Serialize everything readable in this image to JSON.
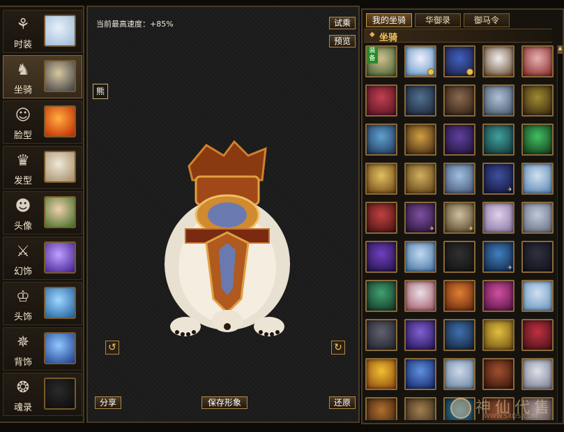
{
  "sidebar": {
    "items": [
      {
        "label": "时装",
        "icon": "fashion-robe-icon",
        "glyph": "⚘",
        "thumb": [
          "#e8f0f8",
          "#9ab8d8"
        ],
        "active": false
      },
      {
        "label": "坐骑",
        "icon": "horse-head-icon",
        "glyph": "♞",
        "thumb": [
          "#d8c8a0",
          "#3a3a40"
        ],
        "active": true
      },
      {
        "label": "脸型",
        "icon": "face-icon",
        "glyph": "☺",
        "thumb": [
          "#ffb040",
          "#c02000"
        ],
        "active": false
      },
      {
        "label": "发型",
        "icon": "hairstyle-icon",
        "glyph": "♛",
        "thumb": [
          "#f0e8d8",
          "#a08860"
        ],
        "active": false
      },
      {
        "label": "头像",
        "icon": "portrait-icon",
        "glyph": "☻",
        "thumb": [
          "#f0d0b0",
          "#3a6a20"
        ],
        "active": false
      },
      {
        "label": "幻饰",
        "icon": "phantom-ornament-icon",
        "glyph": "⚔",
        "thumb": [
          "#c0a0ff",
          "#3a1a8a"
        ],
        "active": false
      },
      {
        "label": "头饰",
        "icon": "headwear-icon",
        "glyph": "♔",
        "thumb": [
          "#a0d8ff",
          "#1a5a9a"
        ],
        "active": false
      },
      {
        "label": "背饰",
        "icon": "back-ornament-icon",
        "glyph": "✵",
        "thumb": [
          "#90c8ff",
          "#1a3a8a"
        ],
        "active": false
      },
      {
        "label": "魂录",
        "icon": "soul-record-icon",
        "glyph": "❂",
        "thumb": [
          "#2a2a2a",
          "#0a0a0a"
        ],
        "active": false
      }
    ]
  },
  "preview": {
    "speed_label": "当前最高速度：+85%",
    "mount_name": "熊",
    "buttons": {
      "try_ride": "试乘",
      "preview": "预览",
      "share": "分享",
      "save_look": "保存形象",
      "restore": "还原"
    },
    "rotate_left_icon": "rotate-left-icon",
    "rotate_right_icon": "rotate-right-icon"
  },
  "panel": {
    "tabs": [
      "我的坐骑",
      "华御录",
      "御马令"
    ],
    "active_tab": 0,
    "section_title": "坐骑",
    "equip_badge": "装备",
    "slots": [
      [
        "#d0c090",
        "#3a5a2a",
        "equipped"
      ],
      [
        "#f0f0ff",
        "#5a90c0",
        "clock"
      ],
      [
        "#4060c0",
        "#1a1a3a",
        "clock"
      ],
      [
        "#f0f0f0",
        "#604020",
        ""
      ],
      [
        "#e8b0b0",
        "#802020",
        ""
      ],
      [
        "#c04050",
        "#501020",
        ""
      ],
      [
        "#507090",
        "#1a2030",
        ""
      ],
      [
        "#8a6a50",
        "#2a1a10",
        ""
      ],
      [
        "#b0c0d8",
        "#405060",
        ""
      ],
      [
        "#a08a30",
        "#302010",
        ""
      ],
      [
        "#60a0d0",
        "#1a3050",
        ""
      ],
      [
        "#d0a040",
        "#3a2010",
        ""
      ],
      [
        "#6040a0",
        "#1a1030",
        ""
      ],
      [
        "#40a0a0",
        "#103030",
        ""
      ],
      [
        "#40c060",
        "#103018",
        ""
      ],
      [
        "#e0c060",
        "#6a4010",
        ""
      ],
      [
        "#d0b060",
        "#5a3a10",
        ""
      ],
      [
        "#a0c0e0",
        "#405070",
        ""
      ],
      [
        "#4050a0",
        "#101030",
        "fly"
      ],
      [
        "#d0e0f0",
        "#5080b0",
        ""
      ],
      [
        "#c04040",
        "#401010",
        ""
      ],
      [
        "#8050a0",
        "#201030",
        "fly"
      ],
      [
        "#d0c0a0",
        "#4a3a20",
        "fly"
      ],
      [
        "#e0d0e8",
        "#8070a0",
        ""
      ],
      [
        "#c0c8d8",
        "#606880",
        ""
      ],
      [
        "#7040c0",
        "#201040",
        ""
      ],
      [
        "#c0d8f0",
        "#4070a0",
        ""
      ],
      [
        "#303030",
        "#101010",
        ""
      ],
      [
        "#4080c0",
        "#102040",
        "fly"
      ],
      [
        "#303040",
        "#101018",
        ""
      ],
      [
        "#40a070",
        "#103020",
        ""
      ],
      [
        "#e8e0e8",
        "#a05060",
        ""
      ],
      [
        "#e08030",
        "#602010",
        ""
      ],
      [
        "#d050a0",
        "#501040",
        ""
      ],
      [
        "#d0e0f0",
        "#6090c0",
        ""
      ],
      [
        "#606070",
        "#202028",
        ""
      ],
      [
        "#8060d0",
        "#201050",
        ""
      ],
      [
        "#4070b0",
        "#102030",
        ""
      ],
      [
        "#e0c040",
        "#6a4a10",
        ""
      ],
      [
        "#c03040",
        "#401018",
        ""
      ],
      [
        "#f0c030",
        "#8a4010",
        ""
      ],
      [
        "#6090e0",
        "#102060",
        ""
      ],
      [
        "#d0d8e8",
        "#6080a0",
        ""
      ],
      [
        "#a05030",
        "#301008",
        ""
      ],
      [
        "#e0e0e8",
        "#707890",
        ""
      ],
      [
        "#b07030",
        "#301808",
        ""
      ],
      [
        "#a08050",
        "#302010",
        ""
      ],
      [
        "#3080a0",
        "#102030",
        ""
      ],
      [
        "#905030",
        "#2a1008",
        ""
      ],
      [
        "#b0a0a0",
        "#403030",
        ""
      ]
    ]
  },
  "watermark": {
    "text": "神仙代售",
    "url": "WWW.SXDS.COM"
  }
}
